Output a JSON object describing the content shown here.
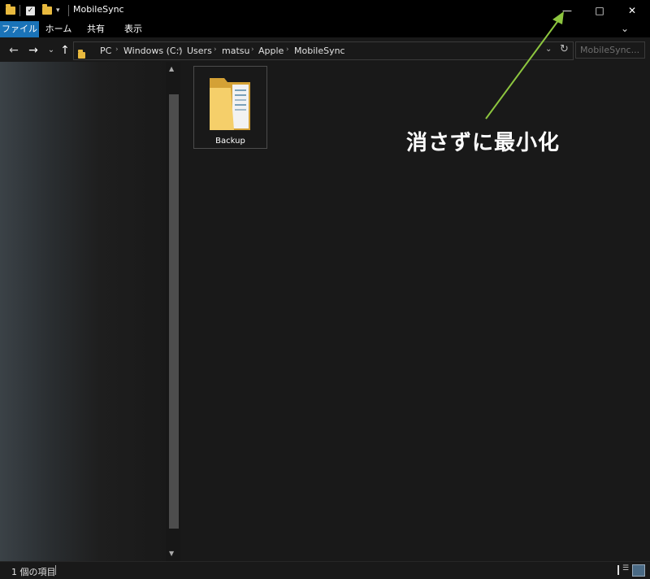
{
  "window": {
    "title": "MobileSync",
    "minimize_glyph": "—",
    "maximize_glyph": "□",
    "close_glyph": "✕",
    "qat_dropdown_glyph": "▾",
    "check_glyph": "✓"
  },
  "ribbon": {
    "tabs": [
      {
        "label": "ファイル",
        "active": true
      },
      {
        "label": "ホーム"
      },
      {
        "label": "共有"
      },
      {
        "label": "表示"
      }
    ],
    "expand_glyph": "⌄",
    "help_glyph": "?"
  },
  "nav": {
    "back_glyph": "←",
    "forward_glyph": "→",
    "recent_glyph": "⌄",
    "up_glyph": "↑",
    "refresh_glyph": "↻",
    "address_dropdown_glyph": "⌄",
    "crumb_separator": "›",
    "breadcrumbs": [
      "PC",
      "Windows (C:)",
      "Users",
      "matsu",
      "Apple",
      "MobileSync"
    ],
    "search_placeholder": "MobileSync..."
  },
  "content": {
    "items": [
      {
        "name": "Backup",
        "type": "folder"
      }
    ]
  },
  "status": {
    "item_count": "1 個の項目"
  },
  "annotation": {
    "text": "消さずに最小化",
    "color": "#8dc63f"
  },
  "colors": {
    "accent": "#1a73b8",
    "folder": "#e8b93e",
    "background": "#191919"
  }
}
